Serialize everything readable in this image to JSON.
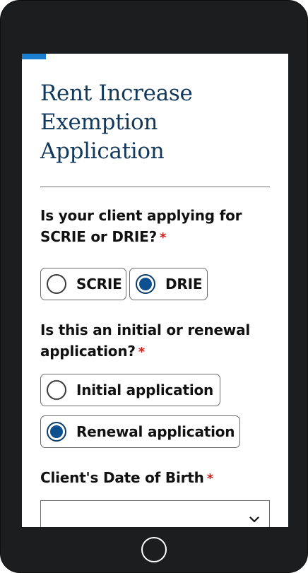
{
  "page": {
    "title": "Rent Increase Exemption Application",
    "progress_fraction": 0.09
  },
  "questions": [
    {
      "label": "Is your client applying for SCRIE or DRIE?",
      "required_mark": "*",
      "options": [
        {
          "label": "SCRIE",
          "checked": false
        },
        {
          "label": "DRIE",
          "checked": true
        }
      ]
    },
    {
      "label": "Is this an initial or renewal application?",
      "required_mark": "*",
      "options": [
        {
          "label": "Initial application",
          "checked": false
        },
        {
          "label": "Renewal application",
          "checked": true
        }
      ]
    },
    {
      "label": "Client's Date of Birth",
      "required_mark": "*",
      "selected_value": "",
      "icon": "chevron-down-icon"
    }
  ],
  "device": {
    "home_button_icon": "home-button"
  },
  "colors": {
    "title": "#12385b",
    "accent": "#1a7fd0",
    "radio_selected": "#0d4f8f",
    "required": "#d0201b",
    "device_frame": "#1c1d1f"
  }
}
